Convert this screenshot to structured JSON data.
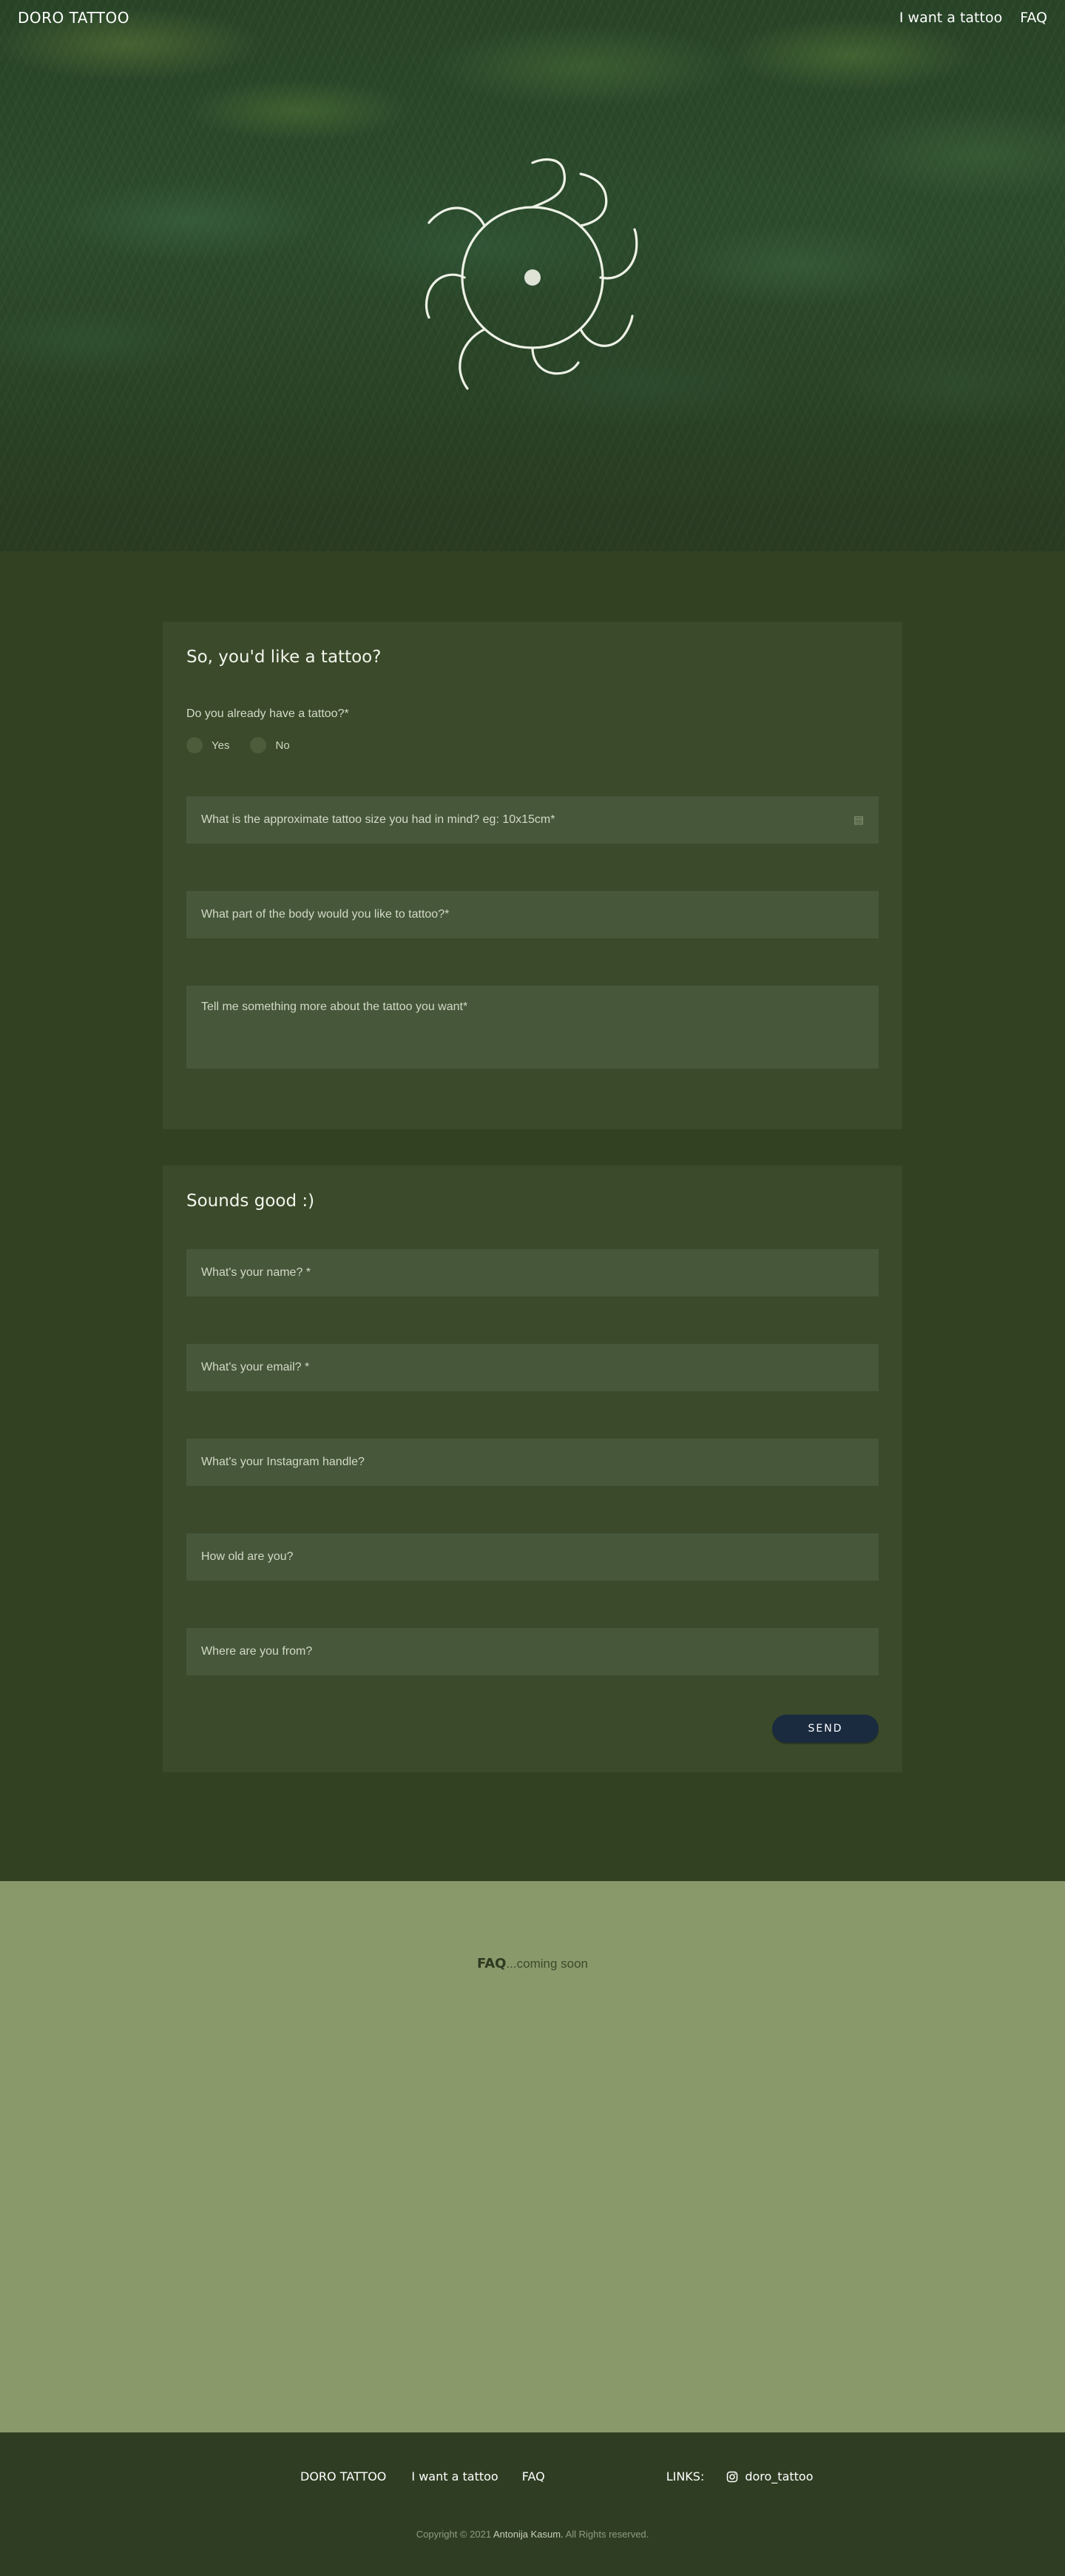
{
  "nav": {
    "brand": "DORO TATTOO",
    "links": [
      "I want a tattoo",
      "FAQ"
    ]
  },
  "hero": {
    "logo_icon": "sun-spiral-logo-icon"
  },
  "form1": {
    "title": "So, you'd like a tattoo?",
    "question": "Do you already have a tattoo?*",
    "radio_yes": "Yes",
    "radio_no": "No",
    "size_placeholder": "What is the approximate tattoo size you had in mind? eg: 10x15cm*",
    "size_icon": "list-icon",
    "body_part_placeholder": "What part of the body would you like to tattoo?*",
    "description_placeholder": "Tell me something more about the tattoo you want*"
  },
  "form2": {
    "title": "Sounds good :)",
    "name_placeholder": "What's your name? *",
    "email_placeholder": "What's your email? *",
    "instagram_placeholder": "What's your Instagram handle?",
    "age_placeholder": "How old are you?",
    "from_placeholder": "Where are you from?",
    "send_label": "SEND",
    "send_color": "#1a2a3f"
  },
  "faq": {
    "heading": "FAQ",
    "text": "...coming soon"
  },
  "footer": {
    "brand": "DORO TATTOO",
    "link_tattoo": "I want a tattoo",
    "link_faq": "FAQ",
    "links_label": "LINKS:",
    "instagram_icon": "instagram-icon",
    "instagram_handle": "doro_tattoo",
    "copyright_prefix": "Copyright © 2021",
    "copyright_author": "Antonija Kasum.",
    "copyright_suffix": "All Rights reserved."
  },
  "colors": {
    "page_bg": "#334123",
    "card_bg": "#3a4a2a",
    "field_bg": "#46573a",
    "faq_bg": "#8a996a",
    "footer_bg": "#2f3e23"
  }
}
